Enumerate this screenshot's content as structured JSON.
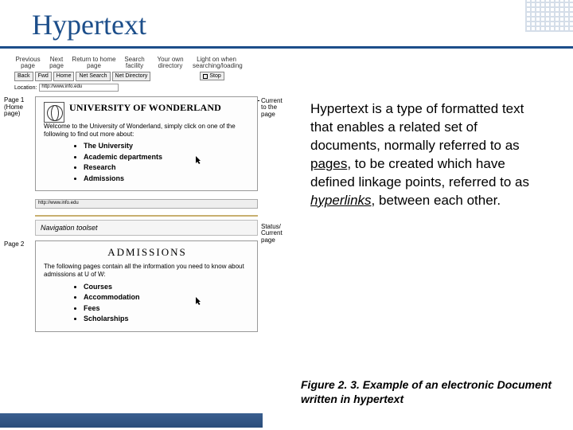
{
  "title": "Hypertext",
  "labels": {
    "prev": "Previous\npage",
    "next": "Next\npage",
    "home": "Return to home\npage",
    "search": "Search\nfacility",
    "dir": "Your own\ndirectory",
    "stop": "Light on when\nsearching/loading"
  },
  "toolbar": {
    "back": "Back",
    "fwd": "Fwd",
    "home": "Home",
    "netsearch": "Net Search",
    "netdir": "Net Directory",
    "stop": "Stop"
  },
  "location_label": "Location:",
  "location_value": "http://www.info.edu",
  "current_page_label": "Current\nto the\npage",
  "page1": {
    "side": "Page 1\n(Home\npage)",
    "heading": "UNIVERSITY OF WONDERLAND",
    "welcome": "Welcome to the University of Wonderland, simply click on one of the following to find out more about:",
    "items": [
      "The University",
      "Academic departments",
      "Research",
      "Admissions"
    ]
  },
  "statusbar_value": "http://www.info.edu",
  "status_label": "Status/\nCurrent\npage",
  "nav_toolset": "Navigation toolset",
  "page2": {
    "side": "Page 2",
    "heading": "ADMISSIONS",
    "text": "The following pages contain all the information you need to know about admissions at U of W:",
    "items": [
      "Courses",
      "Accommodation",
      "Fees",
      "Scholarships"
    ]
  },
  "body_text": {
    "pre1": "Hypertext is a type of formatted text that enables a related set of documents, normally referred to as ",
    "pages": "pages",
    "mid": ", to be created which have defined linkage points, referred to as ",
    "hyperlinks": "hyperlinks",
    "post": ", between each other."
  },
  "caption": "Figure 2. 3. Example of an electronic Document written in hypertext"
}
